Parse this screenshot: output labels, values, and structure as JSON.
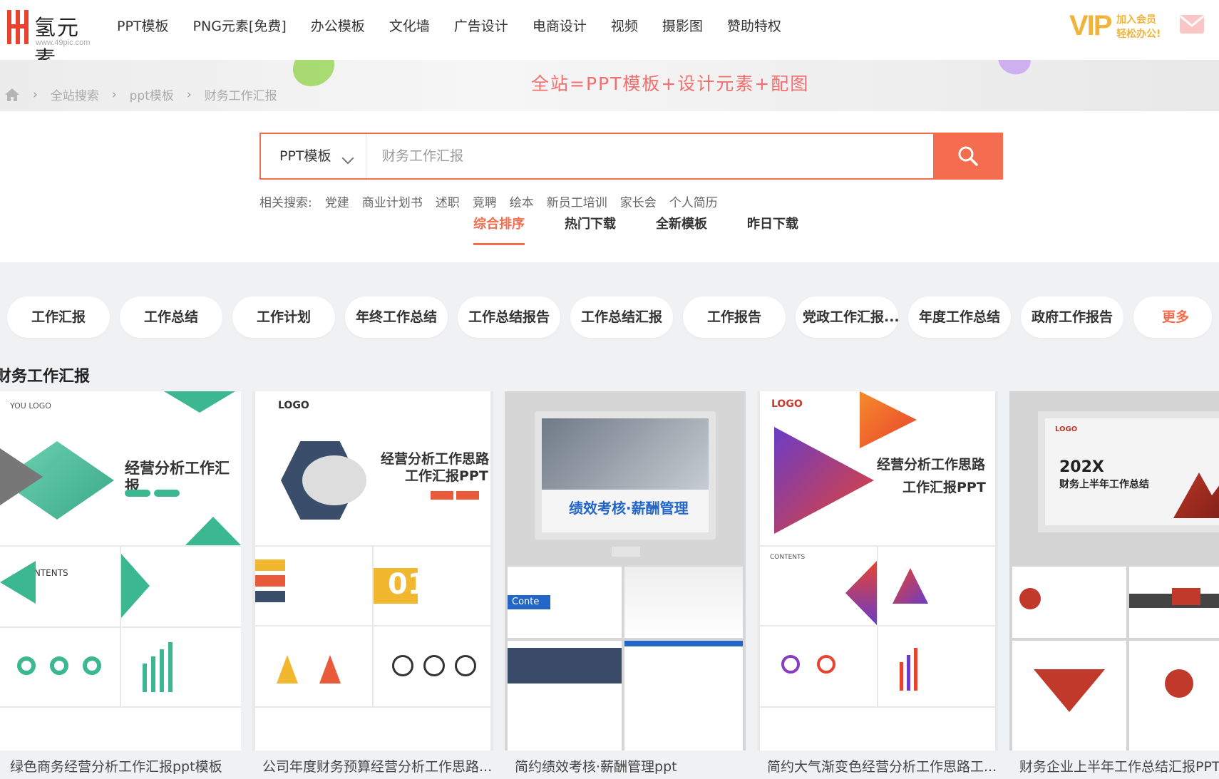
{
  "header": {
    "logo_text": "氢元素",
    "logo_url": "www.49pic.com",
    "nav": [
      "PPT模板",
      "PNG元素[免费]",
      "办公模板",
      "文化墙",
      "广告设计",
      "电商设计",
      "视频",
      "摄影图",
      "赞助特权"
    ],
    "vip_big": "VIP",
    "vip_line1": "加入会员",
    "vip_line2": "轻松办公!"
  },
  "banner": {
    "slogan": "全站=PPT模板+设计元素+配图",
    "breadcrumbs": [
      "全站搜索",
      "ppt模板",
      "财务工作汇报"
    ]
  },
  "search": {
    "category": "PPT模板",
    "placeholder": "财务工作汇报",
    "related_label": "相关搜索:",
    "related": [
      "党建",
      "商业计划书",
      "述职",
      "竞聘",
      "绘本",
      "新员工培训",
      "家长会",
      "个人简历"
    ]
  },
  "tabs": [
    "综合排序",
    "热门下载",
    "全新模板",
    "昨日下载"
  ],
  "tags": [
    "工作汇报",
    "工作总结",
    "工作计划",
    "年终工作总结",
    "工作总结报告",
    "工作总结汇报",
    "工作报告",
    "党政工作汇报...",
    "年度工作总结",
    "政府工作报告",
    "更多"
  ],
  "section_title": "财务工作汇报",
  "cards": [
    {
      "title": "绿色商务经营分析工作汇报ppt模板",
      "headline": "经营分析工作汇报",
      "logo": "YOU LOGO",
      "contents": "CONTENTS"
    },
    {
      "title": "公司年度财务预算经营分析工作思路...",
      "headline": "经营分析工作思路",
      "headline2": "工作汇报PPT",
      "logo": "LOGO",
      "big_num": "01"
    },
    {
      "title": "简约绩效考核·薪酬管理ppt",
      "headline": "绩效考核·薪酬管理",
      "sub": "Conte"
    },
    {
      "title": "简约大气渐变色经营分析工作思路工...",
      "headline": "经营分析工作思路",
      "headline2": "工作汇报PPT",
      "logo": "LOGO",
      "contents": "CONTENTS"
    },
    {
      "title": "财务企业上半年工作总结汇报PPT",
      "headline": "202X",
      "headline2": "财务上半年工作总结",
      "logo": "LOGO"
    }
  ],
  "colors": {
    "accent": "#f46d4e",
    "vip": "#f2b33a",
    "slogan": "#f36f6f"
  }
}
